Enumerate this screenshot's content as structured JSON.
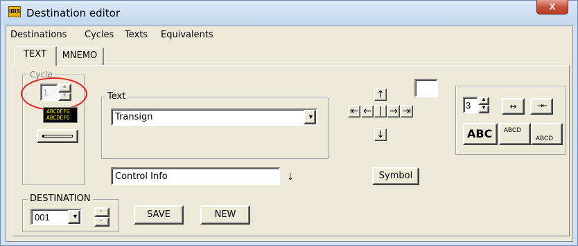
{
  "window": {
    "title": "Destination editor",
    "close_glyph": "X",
    "app_icon_text": "IBIS"
  },
  "menu": [
    "Destinations",
    "Cycles",
    "Texts",
    "Equivalents"
  ],
  "tabs": [
    {
      "label": "TEXT",
      "active": true
    },
    {
      "label": "MNEMO",
      "active": false
    }
  ],
  "cycle": {
    "legend": "Cycle",
    "value": "1",
    "preview_line1": "ABCDEFG",
    "preview_line2": "ABCDEFG"
  },
  "text_group": {
    "legend": "Text",
    "selected": "Transign"
  },
  "control_info": {
    "value": "Control Info",
    "arrow": "↓"
  },
  "arrows": {
    "up": "↑",
    "down": "↓",
    "left_end": "⇤",
    "left": "←",
    "center": "|",
    "right": "→",
    "right_end": "⇥"
  },
  "symbol_button": "Symbol",
  "format": {
    "spin_value": "3",
    "expand": "↔",
    "contract": "→←",
    "abc_big": "ABC",
    "abcd_small_top": "ABCD",
    "abcd_small_bottom": "ABCD"
  },
  "destination": {
    "legend": "DESTINATION",
    "value": "001"
  },
  "buttons": {
    "save": "SAVE",
    "new": "NEW"
  },
  "colors": {
    "highlight": "#e02020",
    "preview_bg": "#000000",
    "preview_fg": "#f2e600",
    "accent": "#6e8fb5"
  }
}
